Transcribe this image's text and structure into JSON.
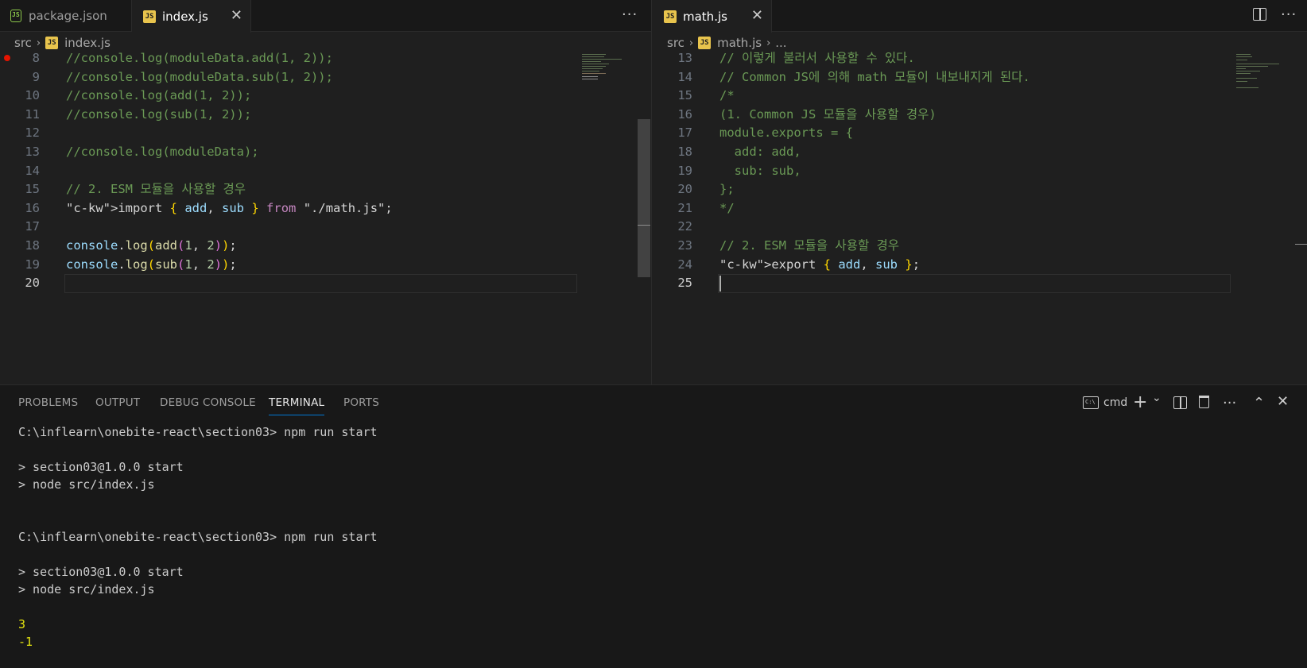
{
  "left_editor": {
    "tabs": [
      {
        "label": "package.json",
        "icon": "node-icon",
        "active": false
      },
      {
        "label": "index.js",
        "icon": "js-icon",
        "active": true
      }
    ],
    "more_label": "···",
    "close_label": "✕",
    "breadcrumb": {
      "folder": "src",
      "file": "index.js"
    },
    "lines": [
      {
        "n": "8",
        "text": "//console.log(moduleData.add(1, 2));"
      },
      {
        "n": "9",
        "text": "//console.log(moduleData.sub(1, 2));"
      },
      {
        "n": "10",
        "text": "//console.log(add(1, 2));"
      },
      {
        "n": "11",
        "text": "//console.log(sub(1, 2));"
      },
      {
        "n": "12",
        "text": ""
      },
      {
        "n": "13",
        "text": "//console.log(moduleData);"
      },
      {
        "n": "14",
        "text": ""
      },
      {
        "n": "15",
        "text": "// 2. ESM 모듈을 사용할 경우"
      },
      {
        "n": "16",
        "text": "import { add, sub } from \"./math.js\";"
      },
      {
        "n": "17",
        "text": ""
      },
      {
        "n": "18",
        "text": "console.log(add(1, 2));"
      },
      {
        "n": "19",
        "text": "console.log(sub(1, 2));"
      },
      {
        "n": "20",
        "text": ""
      }
    ],
    "tokens": {
      "import_kw": "import",
      "brace_open": "{",
      "add": "add",
      "comma": ",",
      "sub": "sub",
      "brace_close": "}",
      "from_kw": "from",
      "path": "\"./math.js\"",
      "semi": ";",
      "console": "console",
      "dot": ".",
      "log": "log",
      "paren_open": "(",
      "args": "1, 2",
      "paren_close": ")",
      "end": ";"
    }
  },
  "right_editor": {
    "tabs": [
      {
        "label": "math.js",
        "icon": "js-icon",
        "active": true
      }
    ],
    "close_label": "✕",
    "more_label": "···",
    "breadcrumb": {
      "folder": "src",
      "file": "math.js",
      "more": "..."
    },
    "lines": [
      {
        "n": "13",
        "text": "// 이렇게 불러서 사용할 수 있다."
      },
      {
        "n": "14",
        "text": "// Common JS에 의해 math 모듈이 내보내지게 된다."
      },
      {
        "n": "15",
        "text": "/*"
      },
      {
        "n": "16",
        "text": "(1. Common JS 모듈을 사용할 경우)"
      },
      {
        "n": "17",
        "text": "module.exports = {"
      },
      {
        "n": "18",
        "text": "  add: add,"
      },
      {
        "n": "19",
        "text": "  sub: sub,"
      },
      {
        "n": "20",
        "text": "};"
      },
      {
        "n": "21",
        "text": "*/"
      },
      {
        "n": "22",
        "text": ""
      },
      {
        "n": "23",
        "text": "// 2. ESM 모듈을 사용할 경우"
      },
      {
        "n": "24",
        "text": "export { add, sub };"
      },
      {
        "n": "25",
        "text": ""
      }
    ],
    "tokens": {
      "export_kw": "export",
      "brace_open": "{",
      "add": "add",
      "comma": ",",
      "sub": "sub",
      "brace_close": "}",
      "semi": ";"
    }
  },
  "panel": {
    "tabs": [
      {
        "label": "PROBLEMS",
        "active": false
      },
      {
        "label": "OUTPUT",
        "active": false
      },
      {
        "label": "DEBUG CONSOLE",
        "active": false
      },
      {
        "label": "TERMINAL",
        "active": true
      },
      {
        "label": "PORTS",
        "active": false
      }
    ],
    "shell_label": "cmd",
    "shell_icon_text": "C:\\",
    "add_label": "+",
    "add_dropdown": "⌄",
    "more_label": "···",
    "maximize_label": "⌃",
    "close_label": "✕",
    "terminal_lines": [
      {
        "text": "C:\\inflearn\\onebite-react\\section03> npm run start",
        "type": "cmd"
      },
      {
        "text": "",
        "type": "blank"
      },
      {
        "text": "> section03@1.0.0 start",
        "type": "cmd"
      },
      {
        "text": "> node src/index.js",
        "type": "cmd"
      },
      {
        "text": "",
        "type": "blank"
      },
      {
        "text": "",
        "type": "blank"
      },
      {
        "text": "C:\\inflearn\\onebite-react\\section03> npm run start",
        "type": "cmd"
      },
      {
        "text": "",
        "type": "blank"
      },
      {
        "text": "> section03@1.0.0 start",
        "type": "cmd"
      },
      {
        "text": "> node src/index.js",
        "type": "cmd"
      },
      {
        "text": "",
        "type": "blank"
      },
      {
        "text": "3",
        "type": "out"
      },
      {
        "text": "-1",
        "type": "out"
      }
    ]
  }
}
